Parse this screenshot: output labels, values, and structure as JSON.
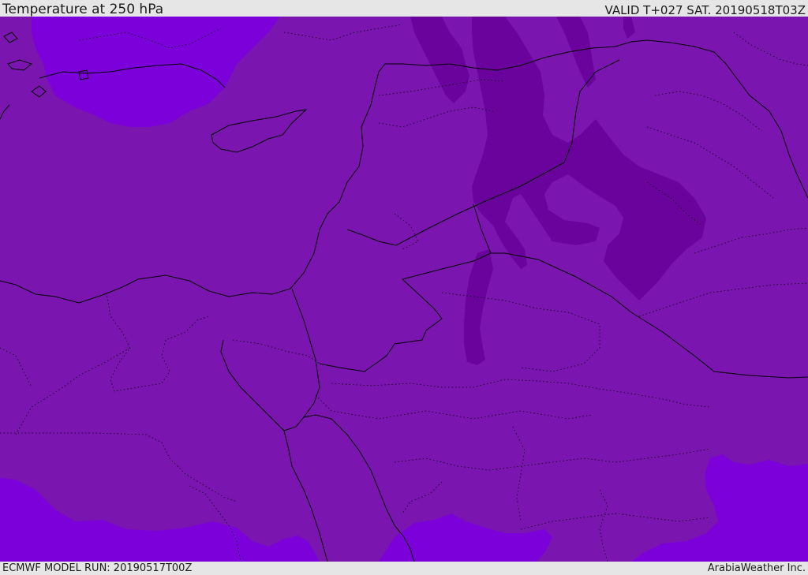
{
  "header": {
    "title": "Temperature at 250 hPa",
    "valid": "VALID T+027 SAT. 20190518T03Z"
  },
  "footer": {
    "model_run": "ECMWF MODEL RUN: 20190517T00Z",
    "credit": "ArabiaWeather Inc."
  },
  "colors": {
    "background_band": "#7a15b0",
    "warm_band": "#7c00da",
    "cold_band": "#6a039c",
    "borders": "#000000",
    "frame": "#e6e6e6"
  }
}
